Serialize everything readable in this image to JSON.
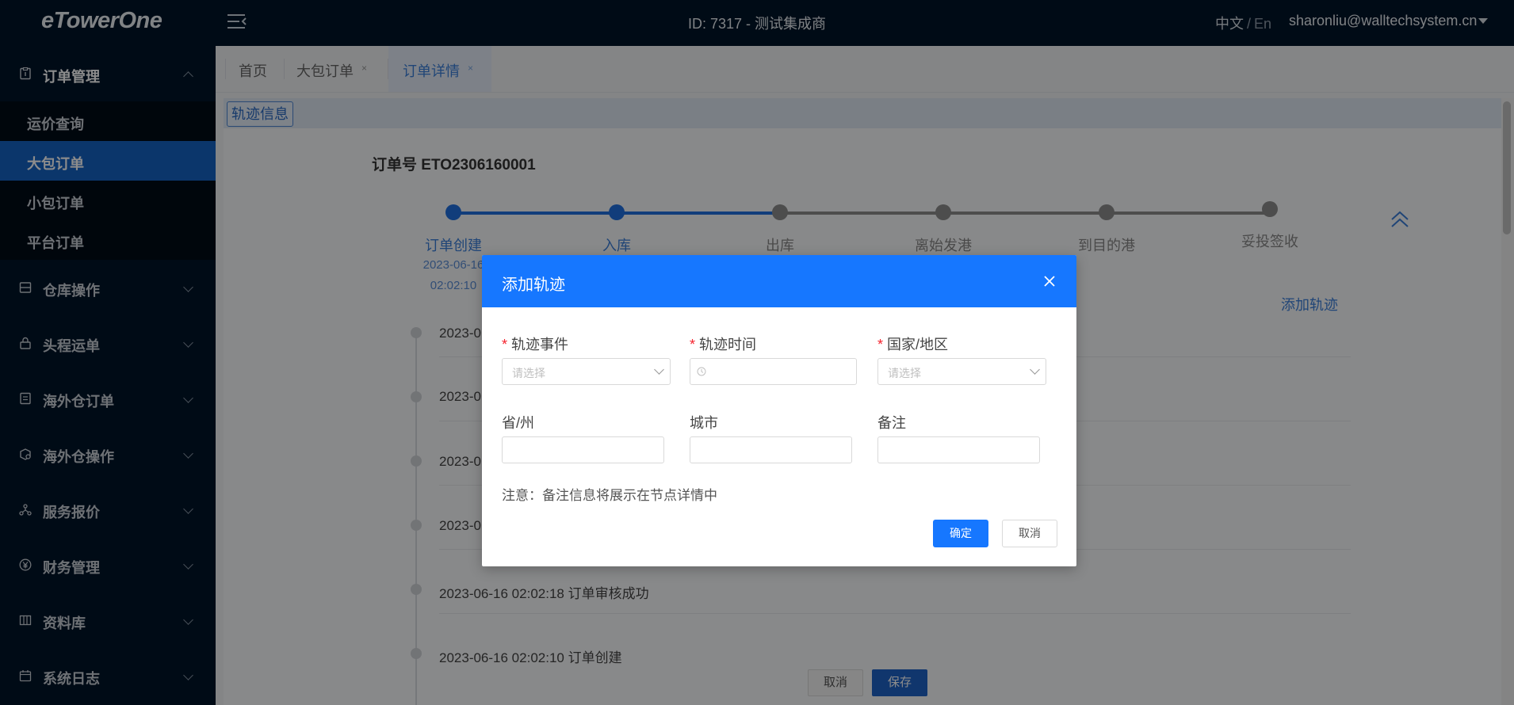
{
  "header": {
    "logo": "eTowerOne",
    "title": "ID: 7317 - 测试集成商",
    "lang_zh": "中文",
    "lang_sep": "/",
    "lang_en": "En",
    "user": "sharonliu@walltechsystem.cn"
  },
  "sidebar": {
    "groups": [
      {
        "label": "订单管理",
        "icon": "order-icon"
      },
      {
        "label": "仓库操作",
        "icon": "warehouse-icon"
      },
      {
        "label": "头程运单",
        "icon": "lock-icon"
      },
      {
        "label": "海外仓订单",
        "icon": "document-icon"
      },
      {
        "label": "海外仓操作",
        "icon": "package-icon"
      },
      {
        "label": "服务报价",
        "icon": "network-icon"
      },
      {
        "label": "财务管理",
        "icon": "yuan-icon"
      },
      {
        "label": "资料库",
        "icon": "database-icon"
      },
      {
        "label": "系统日志",
        "icon": "calendar-icon"
      }
    ],
    "order_items": [
      "运价查询",
      "大包订单",
      "小包订单",
      "平台订单"
    ]
  },
  "tabs": [
    {
      "label": "首页"
    },
    {
      "label": "大包订单",
      "close": "×"
    },
    {
      "label": "订单详情",
      "close": "×"
    }
  ],
  "content": {
    "section_tag": "轨迹信息",
    "order_no": "订单号 ETO2306160001",
    "steps": [
      {
        "label": "订单创建",
        "date": "2023-06-16",
        "time": "02:02:10",
        "done": true
      },
      {
        "label": "入库",
        "done": true
      },
      {
        "label": "出库",
        "done": false
      },
      {
        "label": "离始发港",
        "done": false
      },
      {
        "label": "到目的港",
        "done": false
      },
      {
        "label": "妥投签收",
        "done": false
      }
    ],
    "add_track": "添加轨迹",
    "timeline": [
      "2023-0",
      "2023-0",
      "2023-0",
      "2023-0",
      "2023-06-16 02:02:18 订单审核成功",
      "2023-06-16 02:02:10 订单创建"
    ],
    "cancel": "取消",
    "save": "保存"
  },
  "modal": {
    "title": "添加轨迹",
    "required_mark": "*",
    "event_label": "轨迹事件",
    "event_placeholder": "请选择",
    "time_label": "轨迹时间",
    "country_label": "国家/地区",
    "country_placeholder": "请选择",
    "province_label": "省/州",
    "city_label": "城市",
    "remark_label": "备注",
    "note": "注意：备注信息将展示在节点详情中",
    "ok": "确定",
    "cancel": "取消"
  },
  "colors": {
    "sidebar_bg": "#001529",
    "active_blue": "#1463c3",
    "modal_header": "#1677ff",
    "required": "#f5222d"
  }
}
